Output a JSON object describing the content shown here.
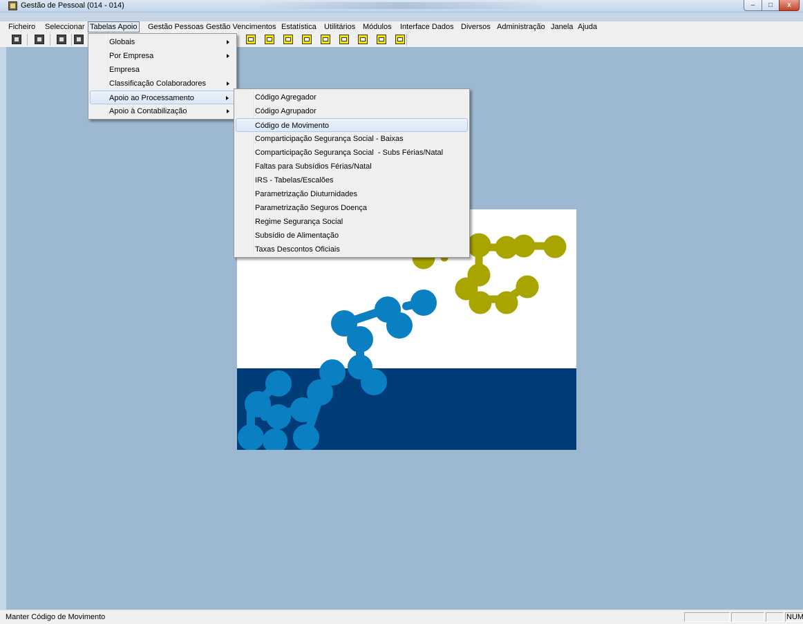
{
  "window": {
    "title": "Gestão de Pessoal (014 - 014)",
    "minimize_label": "–",
    "maximize_label": "□",
    "close_label": "x"
  },
  "menubar": {
    "items": [
      "Ficheiro",
      "Seleccionar",
      "Tabelas Apoio",
      "Gestão Pessoas",
      "Gestão Vencimentos",
      "Estatística",
      "Utilitários",
      "Módulos",
      "Interface Dados",
      "Diversos",
      "Administração",
      "Janela",
      "Ajuda"
    ],
    "active": "Tabelas Apoio"
  },
  "menu_tabelas_apoio": {
    "items": [
      {
        "label": "Globais",
        "submenu": true
      },
      {
        "label": "Por Empresa",
        "submenu": true
      },
      {
        "label": "Empresa",
        "submenu": false
      },
      {
        "label": "Classificação Colaboradores",
        "submenu": true
      },
      {
        "label": "Apoio ao Processamento",
        "submenu": true,
        "highlighted": true
      },
      {
        "label": "Apoio à Contabilização",
        "submenu": true
      }
    ]
  },
  "submenu_apoio_processamento": {
    "items": [
      "Código Agregador",
      "Código Agrupador",
      "Código de Movimento",
      "Comparticipação Segurança Social - Baixas",
      "Comparticipação Segurança Social  - Subs Férias/Natal",
      "Faltas para Subsídios Férias/Natal",
      "IRS - Tabelas/Escalões",
      "Parametrização Diuturnidades",
      "Parametrização Seguros Doença",
      "Regime Segurança Social",
      "Subsídio de Alimentação",
      "Taxas Descontos Oficiais"
    ],
    "highlighted": "Código de Movimento"
  },
  "statusbar": {
    "message": "Manter Código de Movimento",
    "indicator": "NUM"
  },
  "colors": {
    "workspace": "#9db9d1",
    "splash_band": "#003d78",
    "blob_blue": "#0a7fc1",
    "blob_olive": "#a8a400"
  }
}
